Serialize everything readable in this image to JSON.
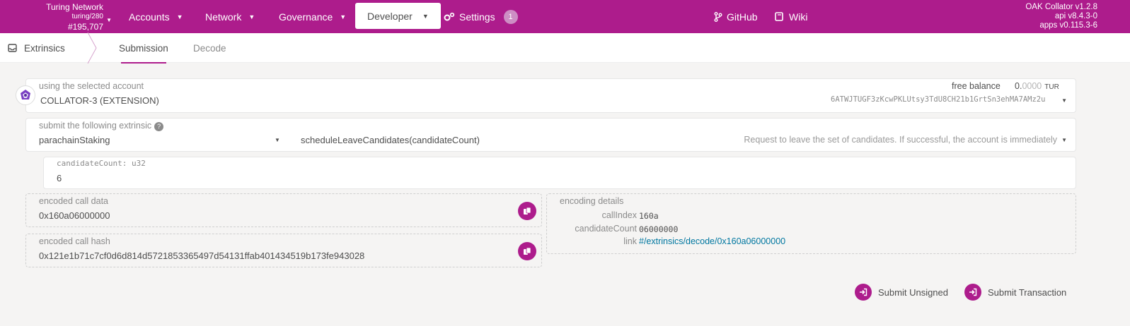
{
  "chain": {
    "name": "Turing Network",
    "spec": "turing/280",
    "block": "#195,707"
  },
  "nav": {
    "accounts": "Accounts",
    "network": "Network",
    "governance": "Governance",
    "developer": "Developer",
    "settings": "Settings",
    "settings_badge": "1",
    "github": "GitHub",
    "wiki": "Wiki"
  },
  "versions": {
    "node": "OAK Collator v1.2.8",
    "api": "api v8.4.3-0",
    "apps": "apps v0.115.3-6"
  },
  "subnav": {
    "section": "Extrinsics",
    "tabs": [
      "Submission",
      "Decode"
    ]
  },
  "account": {
    "label": "using the selected account",
    "name": "COLLATOR-3 (EXTENSION)",
    "free_balance_label": "free balance",
    "balance_int": "0.",
    "balance_dec": "0000",
    "unit": "TUR",
    "address": "6ATWJTUGF3zKcwPKLUtsy3TdU8CH21b1GrtSn3ehMA7AMz2u"
  },
  "extrinsic": {
    "label": "submit the following extrinsic",
    "module": "parachainStaking",
    "method": "scheduleLeaveCandidates(candidateCount)",
    "description": "Request to leave the set of candidates. If successful, the account is immediately"
  },
  "param": {
    "label": "candidateCount: u32",
    "value": "6"
  },
  "encoded_call": {
    "label": "encoded call data",
    "value": "0x160a06000000"
  },
  "encoded_hash": {
    "label": "encoded call hash",
    "value": "0x121e1b71c7cf0d6d814d5721853365497d54131ffab401434519b173fe943028"
  },
  "details": {
    "label": "encoding details",
    "call_index_label": "callIndex",
    "call_index": "160a",
    "candidate_count_label": "candidateCount",
    "candidate_count": "06000000",
    "link_label": "link",
    "link": "#/extrinsics/decode/0x160a06000000"
  },
  "buttons": {
    "submit_unsigned": "Submit Unsigned",
    "submit_transaction": "Submit Transaction"
  },
  "colors": {
    "brand": "#ad1c8c",
    "link": "#0077a0"
  }
}
